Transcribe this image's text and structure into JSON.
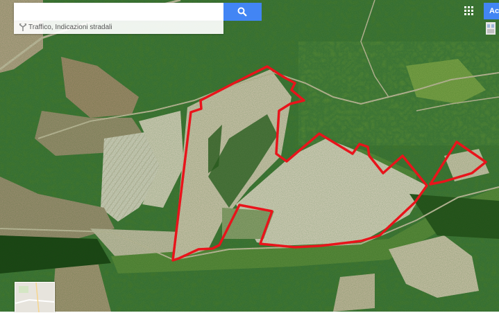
{
  "search": {
    "placeholder": "",
    "value": ""
  },
  "directions": {
    "label": "Traffico, Indicazioni stradali"
  },
  "account": {
    "signin_label": "Accedi"
  },
  "icons": {
    "search": "search-icon",
    "directions": "directions-icon",
    "apps": "apps-grid-icon"
  },
  "colors": {
    "boundary": "#e8141b",
    "accent": "#4285f4"
  }
}
